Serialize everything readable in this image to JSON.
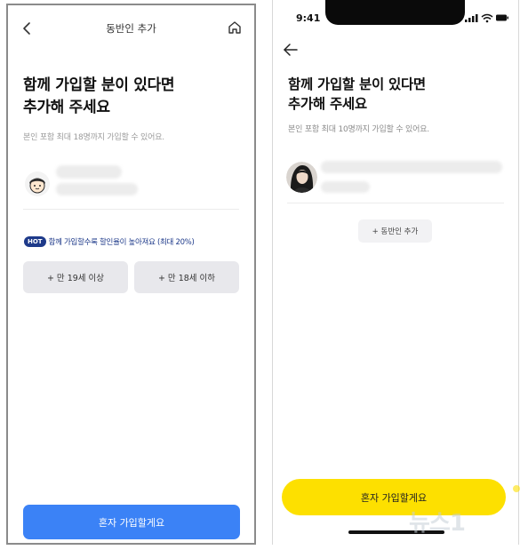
{
  "left": {
    "header_title": "동반인 추가",
    "headline_1": "함께 가입할 분이 있다면",
    "headline_2": "추가해 주세요",
    "subtitle": "본인 포함 최대 18명까지 가입할 수 있어요.",
    "hot_badge": "HOT",
    "hot_text": "함께 가입할수록 할인율이 높아져요 (최대 20%)",
    "age_over_button": "+ 만 19세 이상",
    "age_under_button": "+ 만 18세 이하",
    "primary_button": "혼자 가입할게요",
    "accent_color": "#3b82f6"
  },
  "right": {
    "status_time": "9:41",
    "headline_1": "함께 가입할 분이 있다면",
    "headline_2": "추가해 주세요",
    "subtitle": "본인 포함 최대 10명까지 가입할 수 있어요.",
    "add_companion_button": "+ 동반인 추가",
    "primary_button": "혼자 가입할게요",
    "accent_color": "#fde000"
  },
  "watermark": "뉴스1"
}
